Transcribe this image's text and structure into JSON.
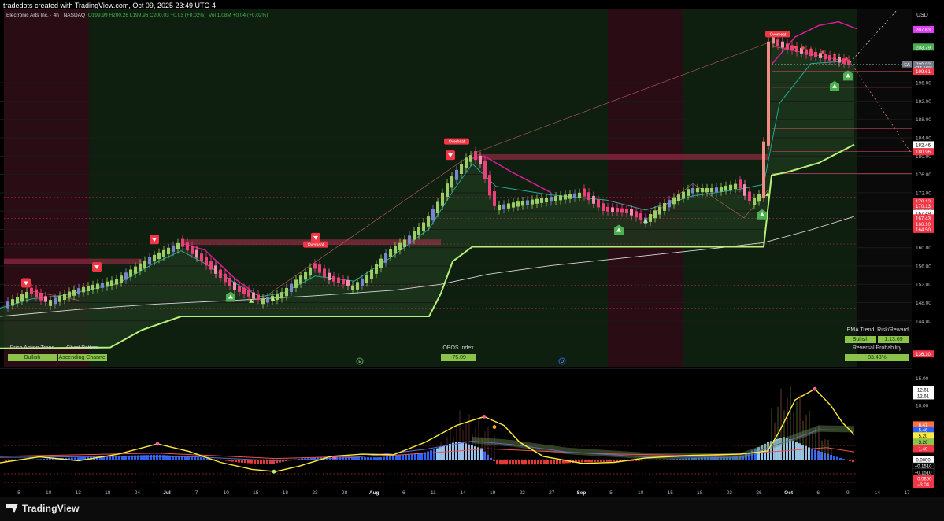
{
  "header": {
    "credit": "tradedots created with TradingView.com, Oct 09, 2025 23:49 UTC-4",
    "symbol": "Electronic Arts Inc. · 4h · NASDAQ",
    "ohlc": "O199.99 H200.26 L199.96 C200.03 +0.03 (+0.02%)",
    "volume": "Vol 1.08M +0.04 (+0.02%)",
    "currency": "USD"
  },
  "panels": {
    "price_action_trend_label": "Price Action Trend",
    "price_action_trend_value": "Bullish",
    "chart_pattern_label": "Chart Pattern",
    "chart_pattern_value": "Ascending Channel",
    "obos_label": "OBOS Index",
    "obos_value": "-75.09",
    "ema_trend_label": "EMA Trend",
    "ema_trend_value": "Bullish",
    "risk_reward_label": "Risk/Reward",
    "risk_reward_value": "1:13.69",
    "reversal_label": "Reversal Probability",
    "reversal_value": "83.48%"
  },
  "markers": {
    "overheat": "Overheat",
    "event_a": "E",
    "event_b": "D"
  },
  "price_badges": [
    {
      "text": "207.63",
      "color": "#e040fb",
      "text_color": "#ffffff",
      "value": 207.63
    },
    {
      "text": "203.79",
      "color": "#4caf50",
      "text_color": "#ffffff",
      "value": 203.79
    },
    {
      "text": "200.03",
      "color": "#787b86",
      "text_color": "#ffffff",
      "value": 200.03
    },
    {
      "text": "+37.16%",
      "color": "#787b86",
      "text_color": "#ffffff",
      "value": 199.3
    },
    {
      "text": "199.61",
      "color": "#f23645",
      "text_color": "#ffffff",
      "value": 198.5
    },
    {
      "text": "182.46",
      "color": "#ffffff",
      "text_color": "#000000",
      "value": 182.46
    },
    {
      "text": "180.96",
      "color": "#f23645",
      "text_color": "#ffffff",
      "value": 180.96
    },
    {
      "text": "170.13",
      "color": "#f23645",
      "text_color": "#ffffff",
      "value": 170.13
    },
    {
      "text": "170.13",
      "color": "#f23645",
      "text_color": "#ffffff",
      "value": 169.1
    },
    {
      "text": "167.49",
      "color": "#ffffff",
      "text_color": "#000000",
      "value": 167.49
    },
    {
      "text": "167.43",
      "color": "#f23645",
      "text_color": "#ffffff",
      "value": 166.5
    },
    {
      "text": "166.10",
      "color": "#f23645",
      "text_color": "#ffffff",
      "value": 165.2
    },
    {
      "text": "164.50",
      "color": "#f23645",
      "text_color": "#ffffff",
      "value": 164.0
    },
    {
      "text": "136.10",
      "color": "#f23645",
      "text_color": "#ffffff",
      "value": 136.8
    }
  ],
  "osc_badges": [
    {
      "text": "12.61",
      "color": "#ffffff",
      "text_color": "#000000",
      "value": 12.9
    },
    {
      "text": "12.61",
      "color": "#ffffff",
      "text_color": "#000000",
      "value": 11.7
    },
    {
      "text": "6.41",
      "color": "#ff7043",
      "text_color": "#ffffff",
      "value": 6.41
    },
    {
      "text": "5.46",
      "color": "#2962ff",
      "text_color": "#ffffff",
      "value": 5.46
    },
    {
      "text": "5.20",
      "color": "#ffeb3b",
      "text_color": "#000000",
      "value": 4.4
    },
    {
      "text": "3.26",
      "color": "#8bc34a",
      "text_color": "#000000",
      "value": 3.26
    },
    {
      "text": "1.40",
      "color": "#f23645",
      "text_color": "#ffffff",
      "value": 2.0
    },
    {
      "text": "0.0000",
      "color": "#ffffff",
      "text_color": "#000000",
      "value": 0.0
    },
    {
      "text": "−0.1510",
      "color": "#000000",
      "text_color": "#ffffff",
      "value": -1.2
    },
    {
      "text": "−0.1510",
      "color": "#000000",
      "text_color": "#ffffff",
      "value": -2.3
    },
    {
      "text": "−0.9690",
      "color": "#f23645",
      "text_color": "#ffffff",
      "value": -3.5
    },
    {
      "text": "−3.04",
      "color": "#f23645",
      "text_color": "#ffffff",
      "value": -4.6
    }
  ],
  "chart_data": {
    "type": "candlestick",
    "title": "Electronic Arts Inc. · 4h · NASDAQ",
    "xlabel": "",
    "ylabel": "",
    "ylim": [
      134,
      212
    ],
    "price_ticks": [
      144,
      148,
      152,
      156,
      160,
      164,
      168,
      172,
      176,
      180,
      184,
      188,
      192,
      196
    ],
    "x_tick_labels": [
      "5",
      "10",
      "13",
      "18",
      "24",
      "Jul",
      "7",
      "10",
      "15",
      "18",
      "23",
      "28",
      "Aug",
      "6",
      "11",
      "14",
      "19",
      "22",
      "27",
      "Sep",
      "5",
      "10",
      "15",
      "18",
      "23",
      "26",
      "Oct",
      "6",
      "9",
      "14",
      "17"
    ],
    "price_key_points": [
      [
        0,
        147
      ],
      [
        40,
        150.5
      ],
      [
        60,
        148
      ],
      [
        100,
        151
      ],
      [
        150,
        153
      ],
      [
        195,
        158
      ],
      [
        230,
        161
      ],
      [
        260,
        157
      ],
      [
        300,
        151
      ],
      [
        330,
        148.5
      ],
      [
        360,
        150
      ],
      [
        400,
        156
      ],
      [
        420,
        153
      ],
      [
        450,
        151.5
      ],
      [
        470,
        154
      ],
      [
        495,
        159
      ],
      [
        520,
        162
      ],
      [
        545,
        166
      ],
      [
        560,
        170
      ],
      [
        575,
        175
      ],
      [
        600,
        180.5
      ],
      [
        615,
        178
      ],
      [
        630,
        169
      ],
      [
        660,
        170
      ],
      [
        700,
        171
      ],
      [
        740,
        172
      ],
      [
        770,
        168
      ],
      [
        800,
        167.5
      ],
      [
        820,
        166
      ],
      [
        850,
        170
      ],
      [
        880,
        173
      ],
      [
        910,
        173
      ],
      [
        940,
        174
      ],
      [
        955,
        170
      ],
      [
        970,
        172
      ],
      [
        975,
        186
      ],
      [
        980,
        205
      ],
      [
        1000,
        203.5
      ],
      [
        1030,
        202
      ],
      [
        1055,
        201
      ],
      [
        1080,
        200
      ]
    ],
    "ema_fast_key_points": [
      [
        0,
        146.8
      ],
      [
        40,
        148.8
      ],
      [
        80,
        149.6
      ],
      [
        150,
        152.2
      ],
      [
        195,
        156.5
      ],
      [
        230,
        159.3
      ],
      [
        260,
        156.6
      ],
      [
        300,
        152.1
      ],
      [
        330,
        149.3
      ],
      [
        360,
        150.1
      ],
      [
        400,
        153.8
      ],
      [
        450,
        152.7
      ],
      [
        495,
        157.7
      ],
      [
        545,
        164.1
      ],
      [
        575,
        172.3
      ],
      [
        600,
        178.3
      ],
      [
        630,
        173.4
      ],
      [
        700,
        171.5
      ],
      [
        770,
        170.4
      ],
      [
        820,
        168.2
      ],
      [
        880,
        171.3
      ],
      [
        940,
        172.8
      ],
      [
        970,
        173.8
      ],
      [
        990,
        191.5
      ],
      [
        1030,
        200.2
      ],
      [
        1080,
        200.8
      ]
    ],
    "ema_slow_key_points": [
      [
        0,
        145
      ],
      [
        100,
        146.5
      ],
      [
        200,
        147.7
      ],
      [
        300,
        148.5
      ],
      [
        400,
        149.5
      ],
      [
        500,
        150.7
      ],
      [
        560,
        152
      ],
      [
        620,
        154.2
      ],
      [
        700,
        156.1
      ],
      [
        800,
        157.9
      ],
      [
        900,
        159.7
      ],
      [
        970,
        161.1
      ],
      [
        1030,
        163.9
      ],
      [
        1085,
        166.8
      ]
    ],
    "support_key_points": [
      [
        0,
        138
      ],
      [
        140,
        138.2
      ],
      [
        180,
        142
      ],
      [
        230,
        145
      ],
      [
        300,
        145
      ],
      [
        400,
        145
      ],
      [
        545,
        145
      ],
      [
        560,
        150
      ],
      [
        575,
        157
      ],
      [
        600,
        160.2
      ],
      [
        700,
        160.2
      ],
      [
        800,
        160.2
      ],
      [
        970,
        160.2
      ],
      [
        980,
        175.8
      ],
      [
        1000,
        176.5
      ],
      [
        1040,
        178.5
      ],
      [
        1085,
        182.5
      ]
    ],
    "overheat_curve_key_points": [
      [
        230,
        161
      ],
      [
        260,
        159.5
      ],
      [
        300,
        153
      ],
      [
        320,
        150.5
      ],
      [
        600,
        179.5
      ],
      [
        615,
        180
      ],
      [
        650,
        176.5
      ],
      [
        700,
        172
      ],
      [
        980,
        200
      ],
      [
        1010,
        206
      ],
      [
        1040,
        208.5
      ],
      [
        1065,
        209.3
      ],
      [
        1088,
        207.8
      ]
    ],
    "bearish_zones_x": [
      [
        5,
        113
      ],
      [
        772,
        868
      ]
    ],
    "resistance_bands": [
      {
        "y": 157,
        "x0": 5,
        "x1": 180
      },
      {
        "y": 161.2,
        "x0": 230,
        "x1": 560
      },
      {
        "y": 179.8,
        "x0": 605,
        "x1": 975
      }
    ],
    "osc_ylim": [
      -5.5,
      16.5
    ],
    "osc_ticks": [
      15,
      10
    ],
    "osc_series": {
      "yellow": [
        [
          0,
          -0.6
        ],
        [
          50,
          0.5
        ],
        [
          100,
          -0.2
        ],
        [
          150,
          1.0
        ],
        [
          200,
          2.9
        ],
        [
          240,
          1.5
        ],
        [
          280,
          -0.5
        ],
        [
          320,
          -1.8
        ],
        [
          350,
          -2.2
        ],
        [
          380,
          -1.2
        ],
        [
          420,
          0.6
        ],
        [
          460,
          1.0
        ],
        [
          500,
          0.9
        ],
        [
          540,
          3.2
        ],
        [
          580,
          6.3
        ],
        [
          615,
          7.9
        ],
        [
          640,
          6.3
        ],
        [
          660,
          3.2
        ],
        [
          690,
          0.6
        ],
        [
          740,
          -0.7
        ],
        [
          780,
          -0.5
        ],
        [
          820,
          0.3
        ],
        [
          880,
          0.8
        ],
        [
          940,
          1.0
        ],
        [
          975,
          1.6
        ],
        [
          990,
          5.2
        ],
        [
          1010,
          11.0
        ],
        [
          1035,
          13.0
        ],
        [
          1055,
          10.0
        ],
        [
          1070,
          6.8
        ],
        [
          1085,
          4.6
        ]
      ],
      "blue": [
        [
          0,
          0.4
        ],
        [
          150,
          0.6
        ],
        [
          250,
          0.5
        ],
        [
          350,
          -0.2
        ],
        [
          450,
          0.4
        ],
        [
          540,
          1.9
        ],
        [
          600,
          3.4
        ],
        [
          650,
          2.8
        ],
        [
          720,
          1.4
        ],
        [
          820,
          0.5
        ],
        [
          940,
          0.4
        ],
        [
          1000,
          3.4
        ],
        [
          1040,
          5.5
        ],
        [
          1085,
          5.4
        ]
      ],
      "red": [
        [
          0,
          0.6
        ],
        [
          200,
          1.2
        ],
        [
          350,
          0.2
        ],
        [
          500,
          0.8
        ],
        [
          620,
          2.0
        ],
        [
          760,
          1.1
        ],
        [
          900,
          0.7
        ],
        [
          985,
          1.5
        ],
        [
          1050,
          2.2
        ],
        [
          1085,
          1.4
        ]
      ]
    },
    "osc_hist_key_points": [
      [
        0,
        -0.4
      ],
      [
        60,
        0.2
      ],
      [
        150,
        0.7
      ],
      [
        200,
        0.9
      ],
      [
        260,
        0.3
      ],
      [
        300,
        -0.5
      ],
      [
        340,
        -0.9
      ],
      [
        380,
        0.2
      ],
      [
        420,
        0.5
      ],
      [
        480,
        0.4
      ],
      [
        540,
        1.4
      ],
      [
        580,
        3.4
      ],
      [
        610,
        2.1
      ],
      [
        630,
        -0.9
      ],
      [
        680,
        -0.9
      ],
      [
        740,
        -0.5
      ],
      [
        800,
        -0.3
      ],
      [
        880,
        0.3
      ],
      [
        940,
        0.6
      ],
      [
        975,
        3.3
      ],
      [
        995,
        4.2
      ],
      [
        1030,
        2.0
      ],
      [
        1060,
        0.6
      ],
      [
        1085,
        -0.6
      ]
    ],
    "osc_spike_key_points": [
      [
        560,
        3.2
      ],
      [
        585,
        9.3
      ],
      [
        605,
        7.6
      ],
      [
        625,
        5.6
      ],
      [
        980,
        9.3
      ],
      [
        995,
        14.0
      ],
      [
        1010,
        13.4
      ],
      [
        1030,
        8.5
      ],
      [
        1055,
        3.0
      ]
    ]
  }
}
